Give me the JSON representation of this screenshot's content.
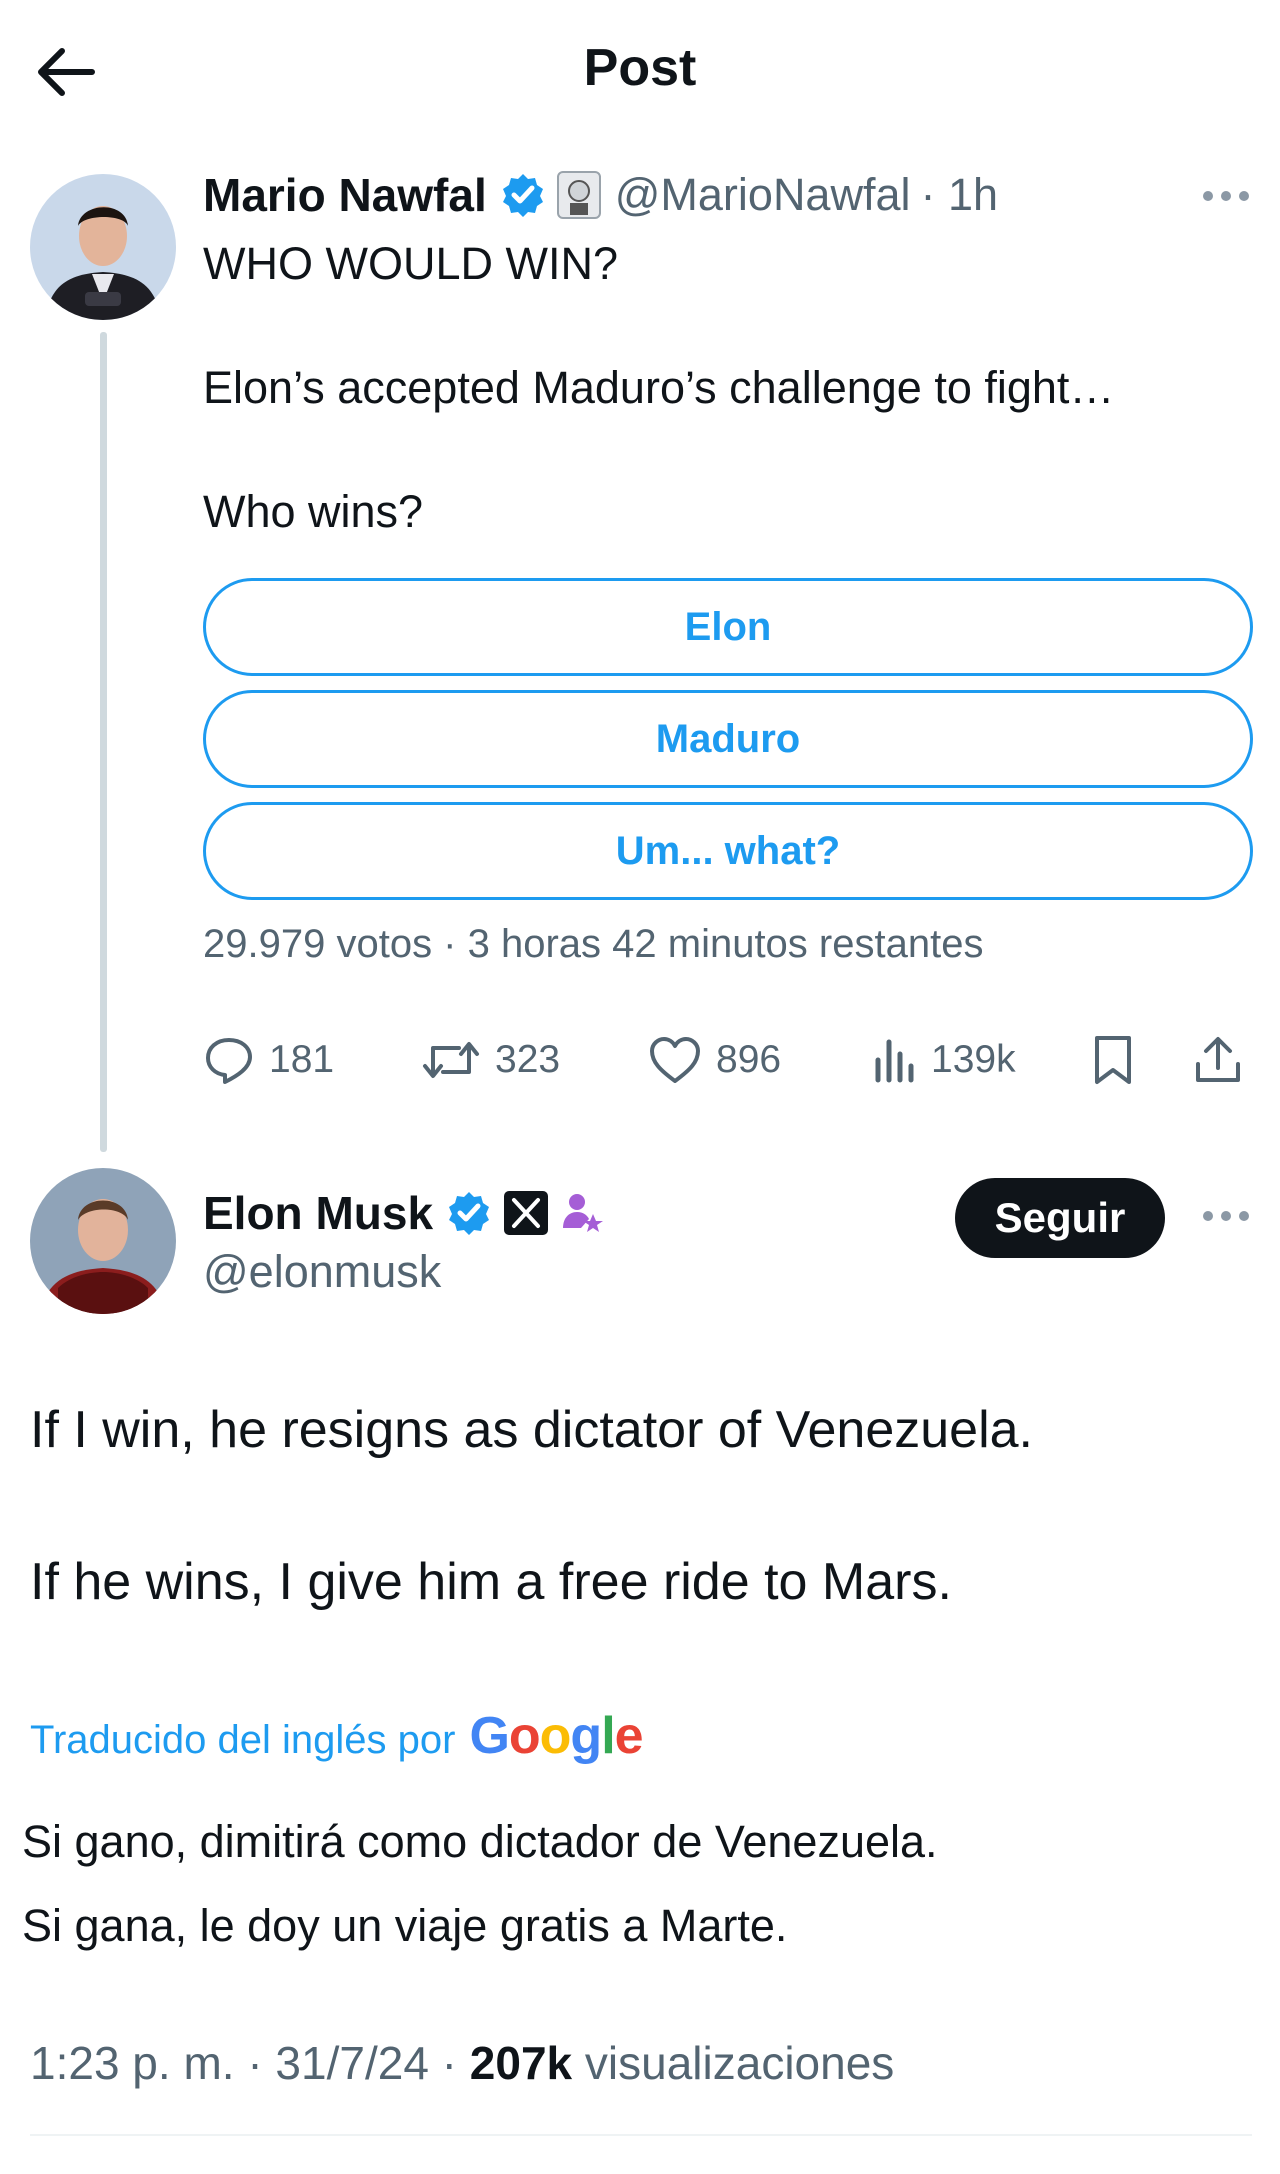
{
  "header": {
    "title": "Post",
    "back_icon": "arrow-left-icon"
  },
  "colors": {
    "accent": "#1d9bf0",
    "text": "#0f1419",
    "muted": "#536471",
    "follow_bg": "#0f1419"
  },
  "quoted_post": {
    "author_name": "Mario Nawfal",
    "handle": "@MarioNawfal",
    "time": "· 1h",
    "text": "WHO WOULD WIN?\n\nElon’s accepted Maduro’s challenge to fight…\n\nWho wins?",
    "poll": {
      "options": [
        "Elon",
        "Maduro",
        "Um... what?"
      ],
      "meta": "29.979 votos · 3 horas 42 minutos restantes"
    },
    "actions": {
      "replies": "181",
      "reposts": "323",
      "likes": "896",
      "views": "139k"
    }
  },
  "main_post": {
    "author_name": "Elon Musk",
    "handle": "@elonmusk",
    "follow_label": "Seguir",
    "line1": "If I win, he resigns as dictator of Venezuela.",
    "line2": "If he wins, I give him a free ride to Mars.",
    "translated_label": "Traducido del inglés por",
    "google": "Google",
    "translation_line1": "Si gano, dimitirá como dictador de Venezuela.",
    "translation_line2": "Si gana, le doy un viaje gratis a Marte.",
    "meta_prefix": "1:23 p. m. · 31/7/24 ·",
    "views_count": "207k",
    "views_label": "visualizaciones"
  }
}
